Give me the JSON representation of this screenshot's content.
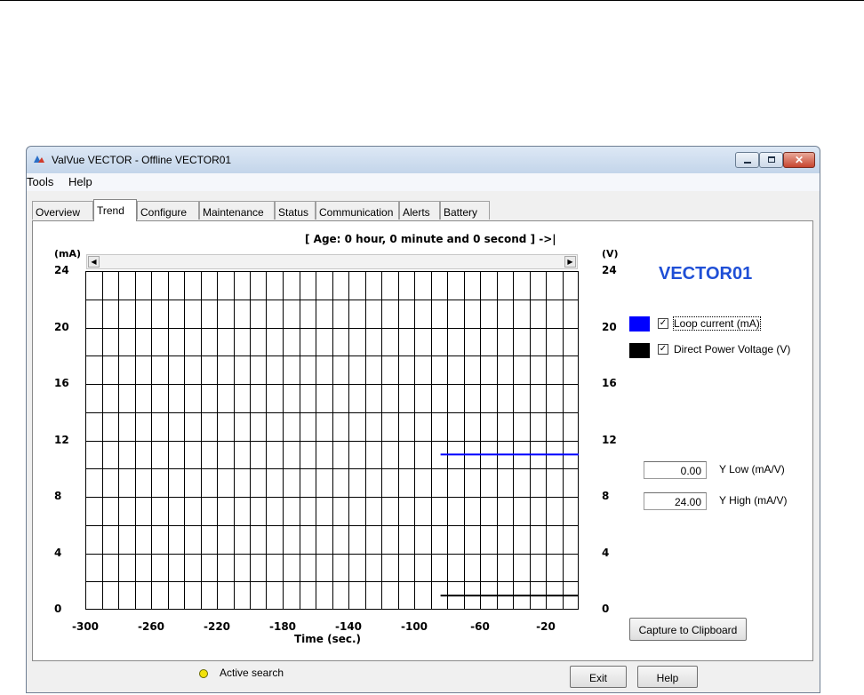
{
  "window": {
    "title": "ValVue VECTOR - Offline  VECTOR01"
  },
  "menu": {
    "items": [
      "Tools",
      "Help"
    ]
  },
  "tabs": [
    {
      "label": "Overview",
      "active": false
    },
    {
      "label": "Trend",
      "active": true
    },
    {
      "label": "Configure",
      "active": false
    },
    {
      "label": "Maintenance",
      "active": false
    },
    {
      "label": "Status",
      "active": false
    },
    {
      "label": "Communication",
      "active": false
    },
    {
      "label": "Alerts",
      "active": false
    },
    {
      "label": "Battery",
      "active": false
    }
  ],
  "trend": {
    "age_label": "[ Age:  0 hour, 0 minute and 0 second ] ->|",
    "left_unit": "(mA)",
    "right_unit": "(V)",
    "device_name": "VECTOR01",
    "legend": [
      {
        "label": "Loop current (mA)",
        "checked": true,
        "color": "#0000ff"
      },
      {
        "label": "Direct Power Voltage (V)",
        "checked": true,
        "color": "#000000"
      }
    ],
    "y_low": {
      "value": "0.00",
      "label": "Y Low (mA/V)"
    },
    "y_high": {
      "value": "24.00",
      "label": "Y High (mA/V)"
    },
    "capture_button": "Capture to Clipboard"
  },
  "chart_data": {
    "type": "line",
    "xlabel": "Time (sec.)",
    "ylabel": "(mA)",
    "y2label": "(V)",
    "xlim": [
      -300,
      0
    ],
    "ylim": [
      0,
      24
    ],
    "x_ticks": [
      "-300",
      "-260",
      "-220",
      "-180",
      "-140",
      "-100",
      "-60",
      "-20"
    ],
    "y_ticks": [
      "24",
      "20",
      "16",
      "12",
      "8",
      "4",
      "0"
    ],
    "x_tick_values": [
      -300,
      -260,
      -220,
      -180,
      -140,
      -100,
      -60,
      -20
    ],
    "y_tick_values": [
      24,
      20,
      16,
      12,
      8,
      4,
      0
    ],
    "grid": true,
    "series": [
      {
        "name": "Loop current (mA)",
        "color": "#0000ff",
        "x": [
          -84,
          0
        ],
        "y": [
          11.0,
          11.0
        ]
      },
      {
        "name": "Direct Power Voltage (V)",
        "color": "#000000",
        "x": [
          -84,
          0
        ],
        "y": [
          1.0,
          1.0
        ]
      }
    ]
  },
  "footer": {
    "status": "Active search",
    "exit_button": "Exit",
    "help_button": "Help"
  }
}
